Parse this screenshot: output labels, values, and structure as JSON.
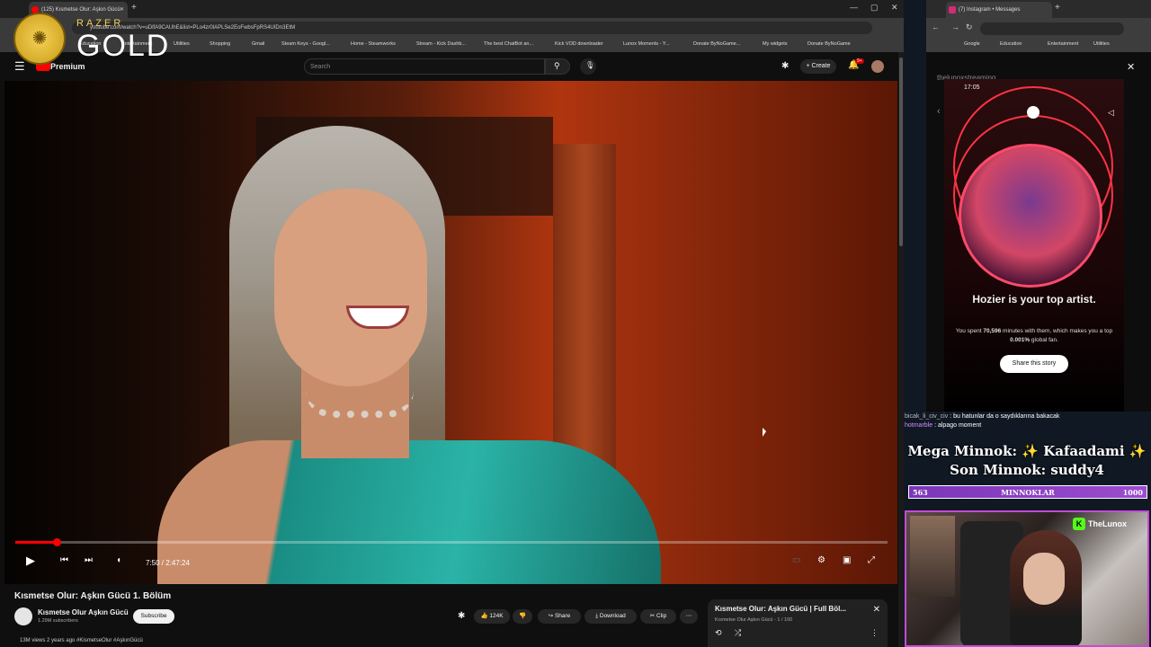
{
  "left_browser": {
    "tab_title": "(125) Kısmetse Olur: Aşkın Gücü",
    "url": "youtube.com/watch?v=uDlfA9CAUhE&list=PLo4zr0lAPLSe2EoFwbsFpRS4UIDn3EtM",
    "bookmarks": [
      "Education",
      "Entertainment",
      "Utilities",
      "Shopping",
      "Gmail",
      "Steam Keys - Googl...",
      "Home - Steamworks",
      "Stream - Kick Dashb...",
      "The best ChatBot an...",
      "Kick VOD downloader",
      "Lunox Moments - Y...",
      "Donate ByNoGame...",
      "My widgets",
      "Donate ByNoGame"
    ]
  },
  "overlay": {
    "razer_brand": "RAZER",
    "gold": "GOLD"
  },
  "youtube": {
    "logo": "Premium",
    "search_placeholder": "Search",
    "create_label": "Create",
    "notif_count": "9+",
    "player": {
      "time": "7:50 / 2:47:24",
      "progress_fraction": 0.047
    },
    "video_title": "Kısmetse Olur: Aşkın Gücü 1. Bölüm",
    "channel_name": "Kısmetse Olur Aşkın Gücü",
    "subscribers": "1.29M subscribers",
    "subscribe_label": "Subscribe",
    "likes": "124K",
    "share_label": "Share",
    "download_label": "Download",
    "clip_label": "Clip",
    "views_line": "13M views  2 years ago  #KismetseOlur #AşkınGücü",
    "playlist": {
      "title": "Kısmetse Olur: Aşkın Gücü | Full Böl...",
      "subtitle": "Kısmetse Olur Aşkın Gücü - 1 / 160"
    }
  },
  "right_browser": {
    "tab_title": "(7) Instagram • Messages",
    "bookmarks": [
      "Google",
      "Education",
      "Entertainment",
      "Utilities"
    ],
    "username": "thelunoxstreaming",
    "story": {
      "time": "17:05",
      "headline": "Hozier is your top artist.",
      "sub_prefix": "You spent ",
      "minutes": "70,596",
      "sub_mid": " minutes with them, which makes you a top ",
      "percent": "0.001%",
      "sub_suffix": " global fan.",
      "share_label": "Share this story"
    }
  },
  "stream": {
    "chat": [
      {
        "user": "bicak_li_civ_civ",
        "message": "bu hatunlar da o saydıklarına bakacak"
      },
      {
        "user": "hotmarble",
        "message": "alpago moment"
      }
    ],
    "mega_line": "Mega Minnok: ✨ Kafaadami ✨",
    "son_line": "Son Minnok: suddy4",
    "bar": {
      "left": "563",
      "label": "MINNOKLAR",
      "right": "1000"
    },
    "webcam_brand": "TheLunox"
  }
}
